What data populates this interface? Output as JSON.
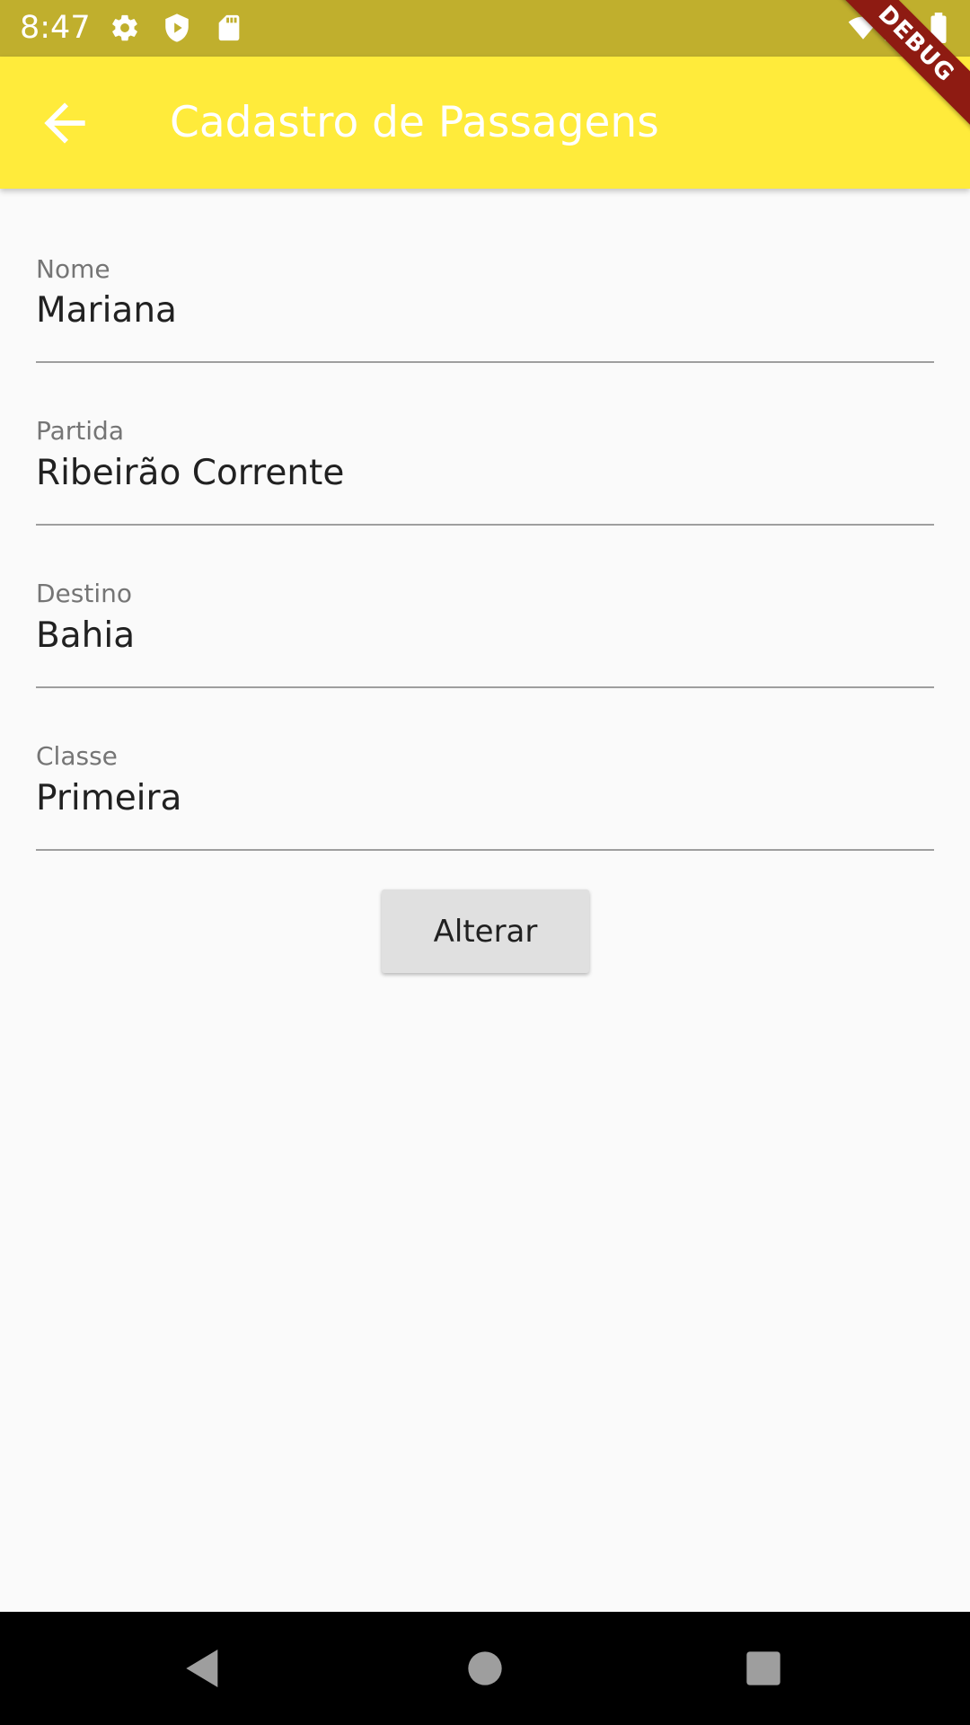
{
  "status_bar": {
    "time": "8:47",
    "icons": [
      "settings-icon",
      "shield-play-icon",
      "sd-card-icon",
      "wifi-icon",
      "signal-icon",
      "battery-icon"
    ],
    "background": "#c0af2d"
  },
  "app_bar": {
    "title": "Cadastro de Passagens",
    "back_icon": "arrow-back-icon",
    "background": "#ffeb3b",
    "title_color": "#ffffff"
  },
  "debug_banner": {
    "label": "DEBUG",
    "color": "#8e1b12"
  },
  "form": {
    "fields": [
      {
        "label": "Nome",
        "value": "Mariana"
      },
      {
        "label": "Partida",
        "value": "Ribeirão Corrente"
      },
      {
        "label": "Destino",
        "value": "Bahia"
      },
      {
        "label": "Classe",
        "value": "Primeira"
      }
    ],
    "submit_label": "Alterar"
  },
  "nav_bar": {
    "buttons": [
      "back-triangle-icon",
      "home-circle-icon",
      "recents-square-icon"
    ]
  }
}
